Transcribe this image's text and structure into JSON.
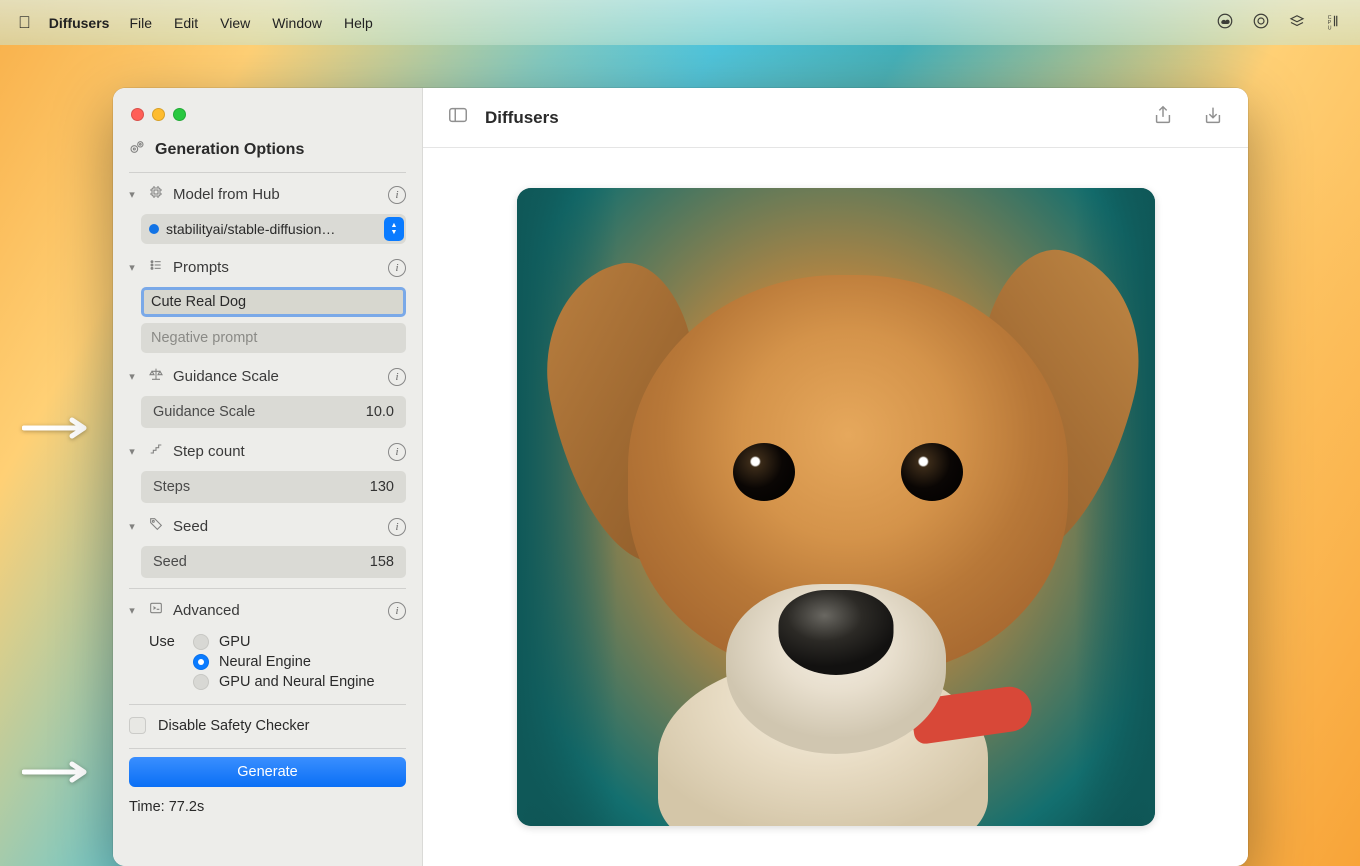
{
  "menubar": {
    "app_name": "Diffusers",
    "items": [
      "File",
      "Edit",
      "View",
      "Window",
      "Help"
    ]
  },
  "window": {
    "toolbar_title": "Diffusers"
  },
  "sidebar": {
    "title": "Generation Options",
    "model": {
      "header": "Model from Hub",
      "selected": "stabilityai/stable-diffusion…"
    },
    "prompts": {
      "header": "Prompts",
      "positive": "Cute Real Dog",
      "negative_placeholder": "Negative prompt"
    },
    "guidance": {
      "header": "Guidance Scale",
      "label": "Guidance Scale",
      "value": "10.0"
    },
    "steps": {
      "header": "Step count",
      "label": "Steps",
      "value": "130"
    },
    "seed": {
      "header": "Seed",
      "label": "Seed",
      "value": "158"
    },
    "advanced": {
      "header": "Advanced",
      "use_label": "Use",
      "options": [
        "GPU",
        "Neural Engine",
        "GPU and Neural Engine"
      ],
      "selected_index": 1
    },
    "safety": {
      "label": "Disable Safety Checker",
      "checked": false
    },
    "generate_label": "Generate",
    "time_label": "Time: 77.2s"
  }
}
